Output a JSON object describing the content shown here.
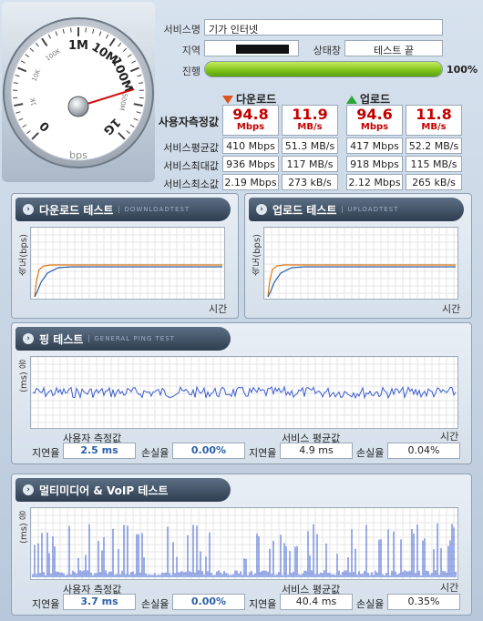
{
  "gauge": {
    "unit": "bps",
    "ticks": [
      "0",
      "1K",
      "10K",
      "100K",
      "1M",
      "10M",
      "100M",
      "500M",
      "1G"
    ]
  },
  "info": {
    "service_label": "서비스명",
    "service_value": "기가 인터넷",
    "region_label": "지역",
    "region_value": "",
    "status_label": "상태창",
    "status_value": "테스트 끝",
    "progress_label": "진행",
    "progress_percent": 100,
    "progress_text": "100%"
  },
  "speed_table": {
    "download_head": "다운로드",
    "upload_head": "업로드",
    "rows": [
      {
        "label": "사용자측정값",
        "down_mbps": "94.8",
        "down_mbps_unit": "Mbps",
        "down_mbs": "11.9",
        "down_mbs_unit": "MB/s",
        "up_mbps": "94.6",
        "up_mbps_unit": "Mbps",
        "up_mbs": "11.8",
        "up_mbs_unit": "MB/s"
      },
      {
        "label": "서비스평균값",
        "down_mbps": "410 Mbps",
        "down_mbs": "51.3 MB/s",
        "up_mbps": "417 Mbps",
        "up_mbs": "52.2 MB/s"
      },
      {
        "label": "서비스최대값",
        "down_mbps": "936 Mbps",
        "down_mbs": "117 MB/s",
        "up_mbps": "918 Mbps",
        "up_mbs": "115 MB/s"
      },
      {
        "label": "서비스최소값",
        "down_mbps": "2.19 Mbps",
        "down_mbs": "273 kB/s",
        "up_mbps": "2.12 Mbps",
        "up_mbs": "265 kB/s"
      }
    ]
  },
  "download_test": {
    "title": "다운로드 테스트",
    "subtitle": "DOWNLOADTEST",
    "ylabel": "속도(bps)",
    "xlabel": "시간"
  },
  "upload_test": {
    "title": "업로드 테스트",
    "subtitle": "UPLOADTEST",
    "ylabel": "속도(bps)",
    "xlabel": "시간"
  },
  "ping_test": {
    "title": "핑 테스트",
    "subtitle": "GENERAL PING TEST",
    "ylabel": "(ms) 응",
    "xlabel": "시간",
    "user_head": "사용자 측정값",
    "service_head": "서비스 평균값",
    "latency_label": "지연율",
    "loss_label": "손실율",
    "user_latency": "2.5 ms",
    "user_loss": "0.00%",
    "service_latency": "4.9 ms",
    "service_loss": "0.04%"
  },
  "voip_test": {
    "title": "멀티미디어 & VoIP 테스트",
    "subtitle": "",
    "ylabel": "(ms) 응",
    "xlabel": "시간",
    "user_head": "사용자 측정값",
    "service_head": "서비스 평균값",
    "latency_label": "지연율",
    "loss_label": "손실율",
    "user_latency": "3.7 ms",
    "user_loss": "0.00%",
    "service_latency": "40.4 ms",
    "service_loss": "0.35%"
  },
  "colors": {
    "download_line": "#e07a1a",
    "upload_line": "#2a5ea8",
    "ping_line": "#3a5cd0",
    "needle": "#d01010"
  }
}
